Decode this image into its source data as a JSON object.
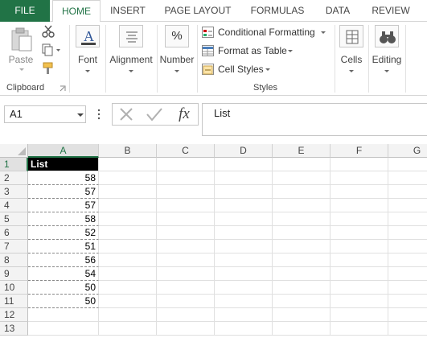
{
  "ribbon_tabs": [
    "FILE",
    "HOME",
    "INSERT",
    "PAGE LAYOUT",
    "FORMULAS",
    "DATA",
    "REVIEW"
  ],
  "active_tab": "HOME",
  "clipboard": {
    "paste": "Paste",
    "group": "Clipboard"
  },
  "font": {
    "label": "Font"
  },
  "alignment": {
    "label": "Alignment"
  },
  "number": {
    "label": "Number",
    "icon_text": "%"
  },
  "styles": {
    "conditional": "Conditional Formatting",
    "format_table": "Format as Table",
    "cell_styles": "Cell Styles",
    "group": "Styles"
  },
  "cells": {
    "label": "Cells"
  },
  "editing": {
    "label": "Editing"
  },
  "formula_bar": {
    "name_box": "A1",
    "fx": "fx",
    "value": "List"
  },
  "columns": [
    "A",
    "B",
    "C",
    "D",
    "E",
    "F",
    "G"
  ],
  "rows": [
    "1",
    "2",
    "3",
    "4",
    "5",
    "6",
    "7",
    "8",
    "9",
    "10",
    "11",
    "12",
    "13"
  ],
  "sheet": {
    "A1": "List",
    "values": [
      "58",
      "57",
      "57",
      "58",
      "52",
      "51",
      "56",
      "54",
      "50",
      "50"
    ]
  },
  "accent": "#217346"
}
